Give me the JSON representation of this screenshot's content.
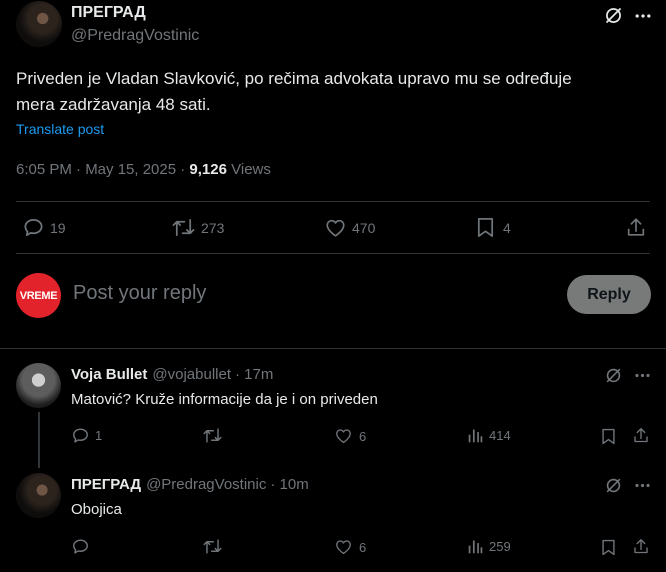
{
  "main_post": {
    "author_name": "ПРЕГРАД",
    "author_handle": "@PredragVostinic",
    "text_line1": "Priveden je Vladan Slavković, po rečima advokata upravo mu se određuje",
    "text_line2": "mera zadržavanja 48 sati.",
    "translate_label": "Translate post",
    "time": "6:05 PM · May 15, 2025 · ",
    "views_count": "9,126",
    "views_label": " Views",
    "stats": {
      "replies": "19",
      "reposts": "273",
      "likes": "470",
      "bookmarks": "4"
    }
  },
  "composer": {
    "avatar_text": "VREME",
    "placeholder": "Post your reply",
    "reply_button": "Reply"
  },
  "replies": [
    {
      "author_name": "Voja Bullet",
      "author_handle": "@vojabullet",
      "time": "· 17m",
      "text": "Matović? Kruže informacije da je i on priveden",
      "stats": {
        "replies": "1",
        "reposts": "",
        "likes": "6",
        "views": "414"
      }
    },
    {
      "author_name": "ПРЕГРАД",
      "author_handle": "@PredragVostinic",
      "time": "· 10m",
      "text": "Obojica",
      "stats": {
        "replies": "",
        "reposts": "",
        "likes": "6",
        "views": "259"
      }
    }
  ],
  "colors": {
    "background": "#000000",
    "text": "#e7e9ea",
    "muted": "#71767b",
    "link": "#1d9bf0",
    "divider": "#2f3336"
  }
}
